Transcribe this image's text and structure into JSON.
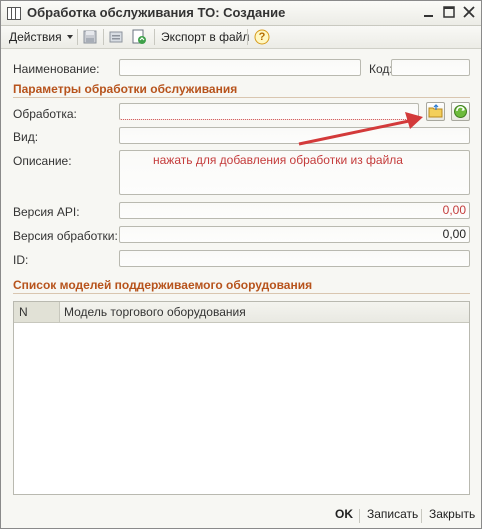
{
  "window": {
    "title": "Обработка обслуживания ТО: Создание",
    "icons": {
      "app": "table-icon",
      "minimize": "minimize-icon",
      "maximize": "maximize-icon",
      "close": "close-icon"
    }
  },
  "toolbar": {
    "actions_label": "Действия",
    "export_label": "Экспорт в файл",
    "help_symbol": "?",
    "icons": [
      "dropdown-arrow-icon",
      "save-disk-icon",
      "copy-icon",
      "refresh-document-icon",
      "help-icon"
    ]
  },
  "form": {
    "name_label": "Наименование:",
    "name_value": "",
    "code_label": "Код:",
    "code_value": ""
  },
  "params_section": {
    "title": "Параметры обработки обслуживания",
    "processing_label": "Обработка:",
    "processing_value": "",
    "kind_label": "Вид:",
    "kind_value": "",
    "description_label": "Описание:",
    "description_value": "",
    "api_version_label": "Версия API:",
    "api_version_value": "0,00",
    "processing_version_label": "Версия обработки:",
    "processing_version_value": "0,00",
    "id_label": "ID:",
    "id_value": "",
    "annotation": "нажать для добавления обработки из файла",
    "colors": {
      "section": "#b7531c",
      "annotation": "#c43b3b",
      "api_value": "#c43b3b",
      "arrow": "#d33a3a"
    }
  },
  "models_section": {
    "title": "Список моделей поддерживаемого оборудования",
    "columns": [
      "N",
      "Модель торгового оборудования"
    ],
    "rows": []
  },
  "bottom": {
    "ok_label": "OK",
    "save_label": "Записать",
    "close_label": "Закрыть"
  }
}
